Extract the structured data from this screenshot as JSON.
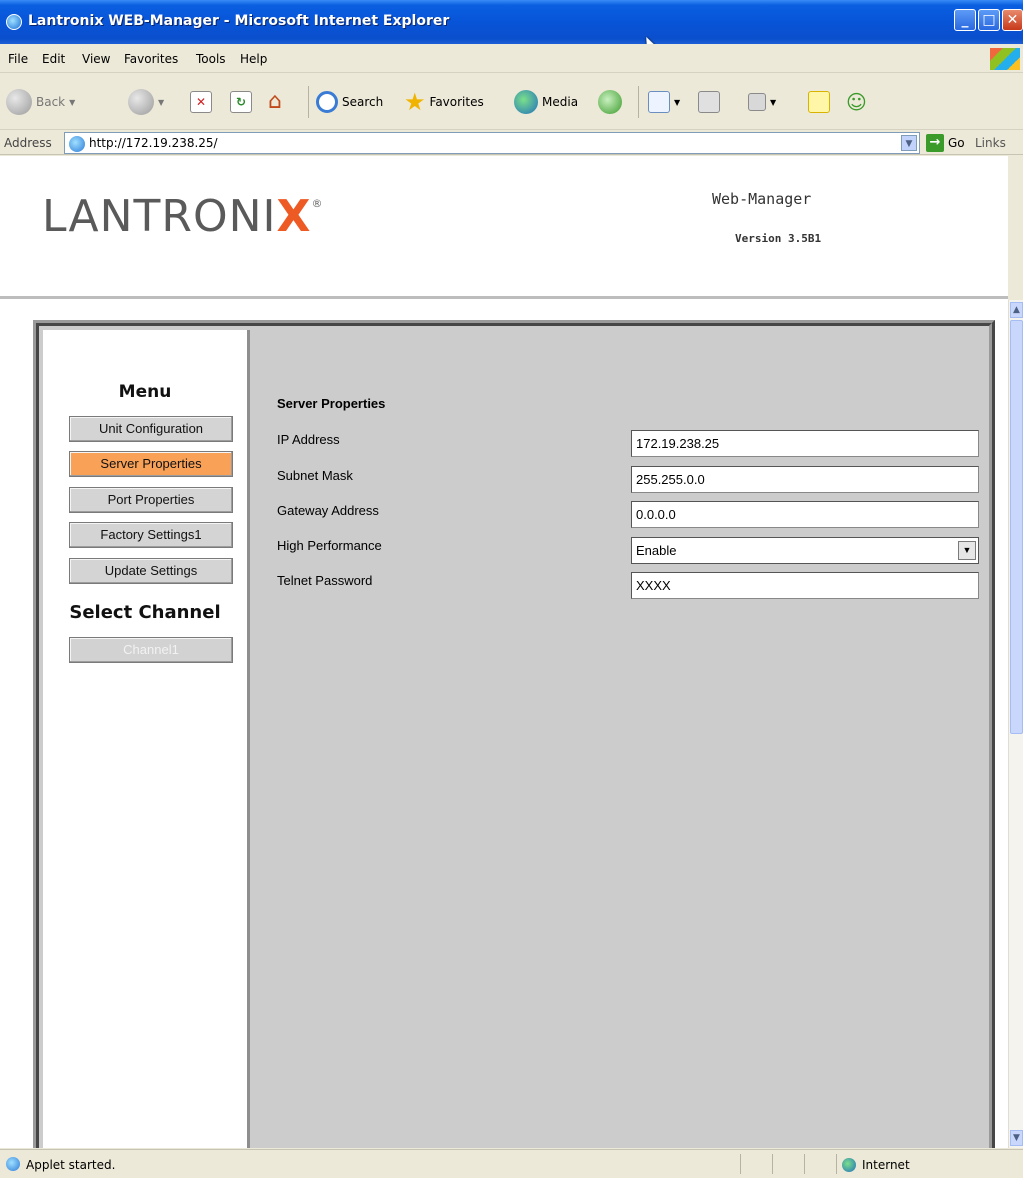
{
  "window": {
    "title": "Lantronix WEB-Manager - Microsoft Internet Explorer",
    "controls": [
      "minimize",
      "maximize",
      "close"
    ]
  },
  "menubar": {
    "items": [
      "File",
      "Edit",
      "View",
      "Favorites",
      "Tools",
      "Help"
    ]
  },
  "toolbar": {
    "back_label": "Back",
    "search_label": "Search",
    "favorites_label": "Favorites",
    "media_label": "Media"
  },
  "addressbar": {
    "label": "Address",
    "url": "http://172.19.238.25/",
    "go_label": "Go",
    "links_label": "Links"
  },
  "header": {
    "logo_text": "LANTRONI",
    "logo_x": "X",
    "logo_reg": "®",
    "product_title": "Web-Manager",
    "version": "Version 3.5B1"
  },
  "menu": {
    "title": "Menu",
    "items": [
      {
        "label": "Unit Configuration"
      },
      {
        "label": "Server Properties",
        "active": true
      },
      {
        "label": "Port Properties"
      },
      {
        "label": "Factory Settings1"
      },
      {
        "label": "Update Settings"
      }
    ],
    "channel_title": "Select Channel",
    "channel_button": "Channel1"
  },
  "form": {
    "title": "Server Properties",
    "fields": [
      {
        "label": "IP Address",
        "value": "172.19.238.25"
      },
      {
        "label": "Subnet Mask",
        "value": "255.255.0.0"
      },
      {
        "label": "Gateway Address",
        "value": "0.0.0.0"
      },
      {
        "label": "High Performance",
        "value": "Enable"
      },
      {
        "label": "Telnet Password",
        "value": "XXXX"
      }
    ]
  },
  "statusbar": {
    "text": "Applet started.",
    "zone": "Internet"
  },
  "colors": {
    "active_menu": "#f8a157",
    "logo_accent": "#ee5a24",
    "panel_bg": "#cccccc"
  }
}
